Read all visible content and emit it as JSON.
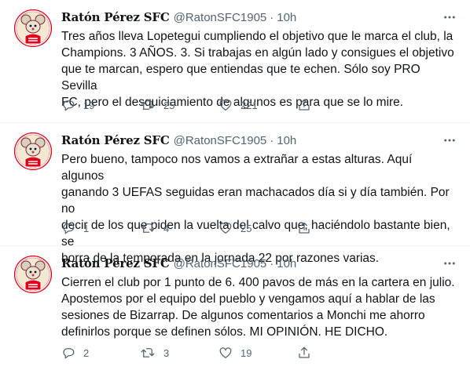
{
  "colors": {
    "text": "#0f1419",
    "muted": "#536471",
    "avatar_bg": "#e2001a",
    "divider": "#eff3f4"
  },
  "icons": {
    "reply": "reply-icon",
    "retweet": "retweet-icon",
    "like": "like-icon",
    "share": "share-icon",
    "more": "more-icon"
  },
  "tweets": [
    {
      "name": "Ratón Pérez SFC",
      "handle": "@RatonSFC1905",
      "separator": "·",
      "time": "10h",
      "text": "Tres años lleva Lopetegui cumpliendo el objetivo que le marca el club, la\nChampions. 3 AÑOS. 3. Si trabajas en algún lado y consigues el objetivo\nque te marcan, espero que entiendas que te echen. Sólo soy PRO Sevilla\nFC, pero el desquiciamiento de algunos es para que se lo mire.",
      "replies": "19",
      "retweets": "25",
      "likes": "221"
    },
    {
      "name": "Ratón Pérez SFC",
      "handle": "@RatonSFC1905",
      "separator": "·",
      "time": "10h",
      "text": "Pero bueno, tampoco nos vamos a extrañar a estas alturas. Aquí algunos\nganando 3 UEFAS seguidas eran machacados día si y día también. Por no\ndecir de los que piden la vuelta del calvo que, haciéndolo bastante bien, se\nborra de la temporada en la jornada 22 por razones varias.",
      "replies": "1",
      "retweets": "4",
      "likes": "25"
    },
    {
      "name": "Ratón Pérez SFC",
      "handle": "@RatonSFC1905",
      "separator": "·",
      "time": "10h",
      "text": "Cierren el club por 1 punto de 6. 400 pavos de más en la cartera en julio.\nApostemos por el equipo del pueblo y vengamos aquí a hablar de las\nsesiones de Bizarrap. De algunos comentarios a Monchi me ahorro\ndefinirlos porque se definen sólos. MI OPINIÓN. HE DICHO.",
      "replies": "2",
      "retweets": "3",
      "likes": "19"
    }
  ]
}
